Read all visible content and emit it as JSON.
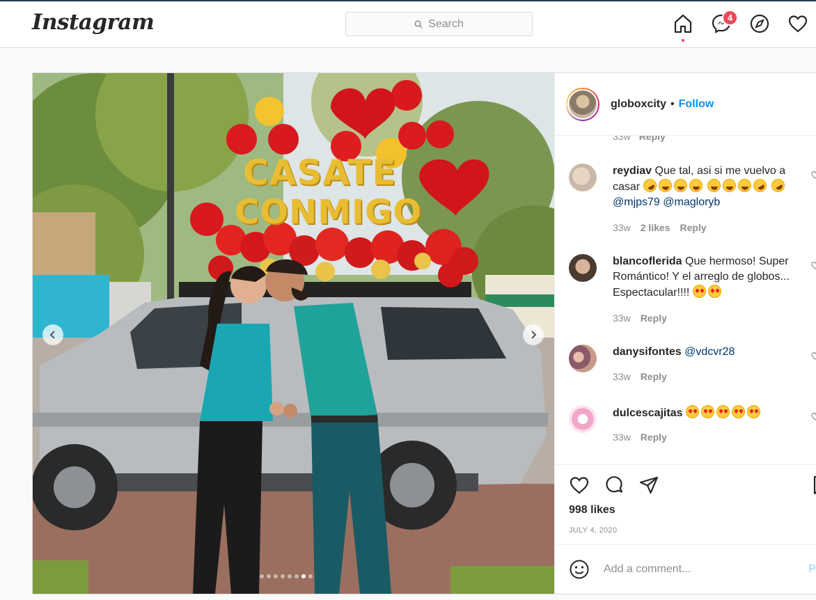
{
  "header": {
    "logo": "Instagram",
    "search_placeholder": "Search",
    "messages_badge": "4",
    "icons": [
      "home-icon",
      "messenger-icon",
      "explore-icon",
      "heart-icon"
    ]
  },
  "post": {
    "owner": "globoxcity",
    "separator": "•",
    "follow_label": "Follow",
    "photo_sign_line1": "CASATE",
    "photo_sign_line2": "CONMIGO",
    "carousel": {
      "total": 8,
      "active_index": 6
    },
    "likes": "998 likes",
    "date": "JULY 4, 2020",
    "add_comment_placeholder": "Add a comment...",
    "post_label": "Post"
  },
  "comments": {
    "cut_time": "33w",
    "cut_reply": "Reply",
    "items": [
      {
        "user": "reydiav",
        "text_a": "Que tal, asi si me vuelvo a casar",
        "mentions": "@mjps79 @magloryb",
        "time": "33w",
        "likes": "2 likes",
        "reply": "Reply",
        "avatar_color": "#c9b8a8"
      },
      {
        "user": "blancoflerida",
        "text_a": "Que hermoso! Super Romántico! Y el arreglo de globos... Espectacular!!!!",
        "time": "33w",
        "reply": "Reply",
        "avatar_color": "#6b5446"
      },
      {
        "user": "danysifontes",
        "mention": "@vdcvr28",
        "time": "33w",
        "reply": "Reply",
        "avatar_color": "#8a5a6a"
      },
      {
        "user": "dulcescajitas",
        "time": "33w",
        "reply": "Reply",
        "avatar_color": "#f2a6c8"
      }
    ]
  },
  "colors": {
    "accent": "#0095f6",
    "badge": "#ed4956",
    "mention": "#00376b",
    "muted": "#8e8e8e"
  }
}
